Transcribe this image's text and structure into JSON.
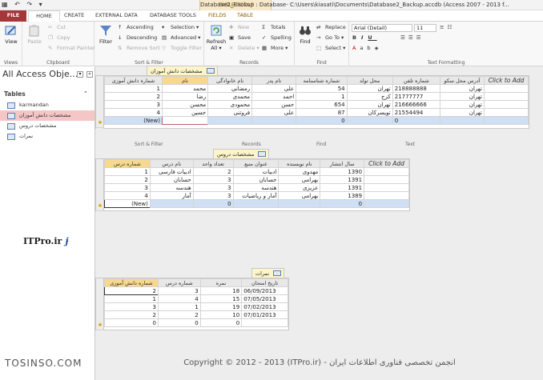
{
  "titlebar": {
    "qat": "▦ ↶ ↷ ▾",
    "title": "Database2_Backup : Database- C:\\Users\\kiasati\\Documents\\Database2_Backup.accdb (Access 2007 - 2013 f...",
    "context": "TABLE TOOLS"
  },
  "tabs": {
    "file": "FILE",
    "home": "HOME",
    "create": "CREATE",
    "external": "EXTERNAL DATA",
    "dbtools": "DATABASE TOOLS",
    "fields": "FIELDS",
    "table": "TABLE"
  },
  "ribbon": {
    "views": {
      "view": "View",
      "label": "Views"
    },
    "clipboard": {
      "paste": "Paste",
      "cut": "Cut",
      "copy": "Copy",
      "format_painter": "Format Painter",
      "label": "Clipboard"
    },
    "sort": {
      "filter": "Filter",
      "ascending": "Ascending",
      "descending": "Descending",
      "remove_sort": "Remove Sort",
      "selection": "Selection ▾",
      "advanced": "Advanced ▾",
      "toggle": "Toggle Filter",
      "label": "Sort & Filter"
    },
    "records": {
      "refresh": "Refresh All ▾",
      "new": "New",
      "save": "Save",
      "delete": "Delete ▾",
      "totals": "Totals",
      "spelling": "Spelling",
      "more": "More ▾",
      "label": "Records"
    },
    "find": {
      "find": "Find",
      "replace": "Replace",
      "goto": "Go To ▾",
      "select": "Select ▾",
      "label": "Find"
    },
    "text": {
      "font": "Arial (Detail)",
      "size": "11",
      "label": "Text Formatting"
    }
  },
  "nav": {
    "title": "All Access Obje...",
    "section": "Tables",
    "items": [
      "karmandan",
      "مشخصات دانش آموزان",
      "مشخصات دروس",
      "نمرات"
    ]
  },
  "table1": {
    "tab": "مشخصات دانش آموزان",
    "headers": [
      "شماره دانش آموزی",
      "نام",
      "نام خانوادگی",
      "نام پدر",
      "شماره شناسنامه",
      "محل تولد",
      "شماره تلفن",
      "آدرس محل سکو",
      "Click to Add"
    ],
    "rows": [
      [
        "1",
        "محمد",
        "رمضانی",
        "علی",
        "54",
        "تهران",
        "218888888",
        "تهران"
      ],
      [
        "2",
        "رضا",
        "محمدی",
        "احمد",
        "1",
        "کرج",
        "21777777",
        "تهران"
      ],
      [
        "3",
        "محسن",
        "محمودی",
        "حسن",
        "654",
        "تهران",
        "216666666",
        "تهران"
      ],
      [
        "4",
        "حسین",
        "فروتنی",
        "علی",
        "87",
        "تویسرکان",
        "21554494",
        "تهران"
      ]
    ],
    "new_row": [
      "(New)",
      "",
      "",
      "",
      "0",
      "",
      "0",
      ""
    ]
  },
  "ghost_labels": {
    "sort": "Sort & Filter",
    "records": "Records",
    "find": "Find",
    "text": "Text"
  },
  "table2": {
    "tab": "مشخصات دروس",
    "headers": [
      "شماره درس",
      "نام درس",
      "تعداد واحد",
      "عنوان منبع",
      "نام نویسنده",
      "سال انتشار",
      "Click to Add"
    ],
    "rows": [
      [
        "1",
        "ادبیات فارسی",
        "2",
        "ادبیات",
        "مهدوی",
        "1390"
      ],
      [
        "2",
        "حسابان",
        "3",
        "حسابان",
        "بهرامی",
        "1391"
      ],
      [
        "3",
        "هندسه",
        "3",
        "هندسه",
        "عزیزی",
        "1391"
      ],
      [
        "4",
        "آمار",
        "3",
        "آمار و ریاضیات",
        "بهرامی",
        "1389"
      ]
    ],
    "new_row": [
      "(New)",
      "",
      "0",
      "",
      "",
      "0"
    ]
  },
  "table3": {
    "tab": "نمرات",
    "headers": [
      "شماره دانش آموزی",
      "شماره درس",
      "نمره",
      "تاریخ امتحان"
    ],
    "rows": [
      [
        "2",
        "3",
        "18",
        "06/09/2013"
      ],
      [
        "1",
        "4",
        "15",
        "07/05/2013"
      ],
      [
        "3",
        "1",
        "19",
        "07/02/2013"
      ],
      [
        "2",
        "2",
        "10",
        "07/01/2013"
      ]
    ],
    "new_row": [
      "0",
      "0",
      "0",
      ""
    ]
  },
  "watermark": {
    "itpro": "ITPro.ir",
    "tosinso": "TOSINSO.COM",
    "footer": "Copyright © 2012 - 2013 (ITPro.ir) - انجمن تخصصی فناوری اطلاعات ایران"
  }
}
